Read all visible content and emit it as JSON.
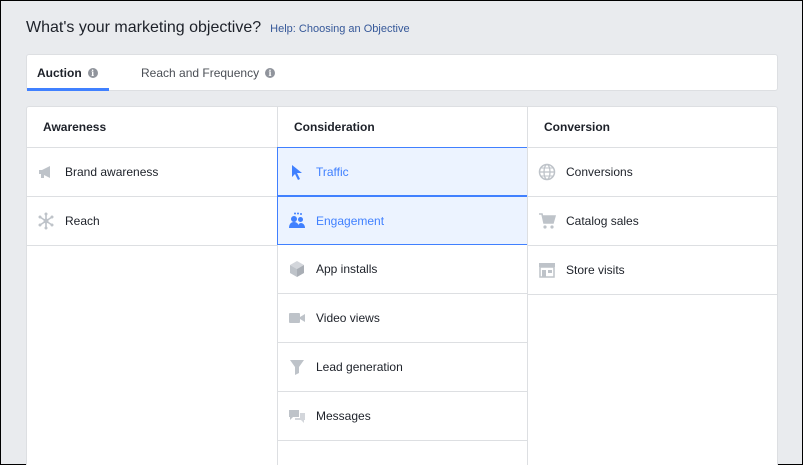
{
  "header": {
    "title": "What's your marketing objective?",
    "help_link": "Help: Choosing an Objective"
  },
  "tabs": [
    {
      "label": "Auction",
      "active": true
    },
    {
      "label": "Reach and Frequency",
      "active": false
    }
  ],
  "colors": {
    "accent": "#4080ff",
    "selected_bg": "#ecf3ff",
    "icon": "#bec3c9",
    "link": "#365899"
  },
  "columns": [
    {
      "title": "Awareness",
      "items": [
        {
          "label": "Brand awareness",
          "icon": "megaphone-icon",
          "selected": false
        },
        {
          "label": "Reach",
          "icon": "reach-icon",
          "selected": false
        }
      ]
    },
    {
      "title": "Consideration",
      "items": [
        {
          "label": "Traffic",
          "icon": "cursor-icon",
          "selected": true
        },
        {
          "label": "Engagement",
          "icon": "people-icon",
          "selected": true
        },
        {
          "label": "App installs",
          "icon": "box-icon",
          "selected": false
        },
        {
          "label": "Video views",
          "icon": "video-camera-icon",
          "selected": false
        },
        {
          "label": "Lead generation",
          "icon": "funnel-icon",
          "selected": false
        },
        {
          "label": "Messages",
          "icon": "chat-bubbles-icon",
          "selected": false
        }
      ]
    },
    {
      "title": "Conversion",
      "items": [
        {
          "label": "Conversions",
          "icon": "globe-icon",
          "selected": false
        },
        {
          "label": "Catalog sales",
          "icon": "shopping-cart-icon",
          "selected": false
        },
        {
          "label": "Store visits",
          "icon": "store-icon",
          "selected": false
        }
      ]
    }
  ]
}
